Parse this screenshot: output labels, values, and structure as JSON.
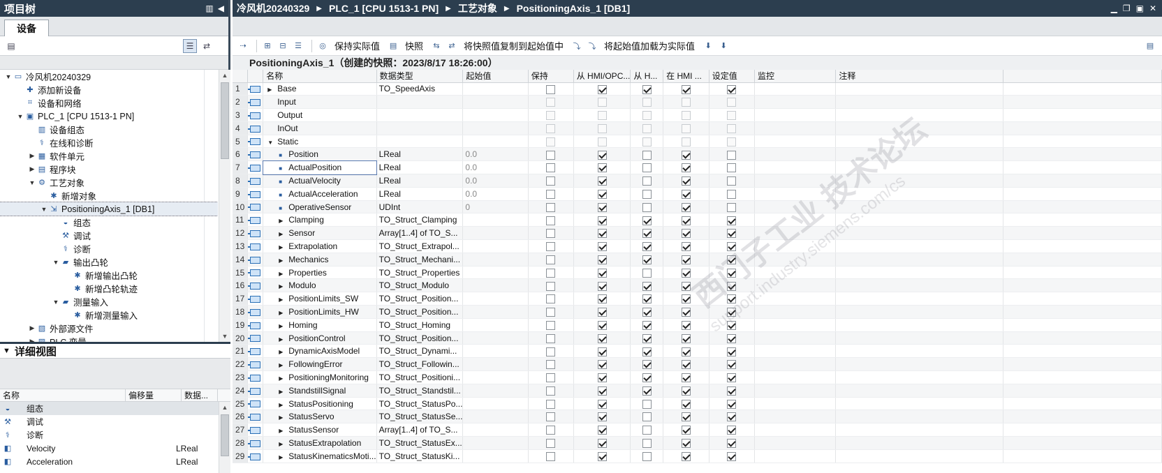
{
  "left": {
    "title": "项目树",
    "tab": "设备",
    "tree": [
      {
        "label": "冷风机20240329",
        "indent": 0,
        "exp": "▼",
        "icon": "project-icon"
      },
      {
        "label": "添加新设备",
        "indent": 1,
        "exp": "",
        "icon": "add-device-icon"
      },
      {
        "label": "设备和网络",
        "indent": 1,
        "exp": "",
        "icon": "network-icon"
      },
      {
        "label": "PLC_1 [CPU 1513-1 PN]",
        "indent": 1,
        "exp": "▼",
        "icon": "plc-icon"
      },
      {
        "label": "设备组态",
        "indent": 2,
        "exp": "",
        "icon": "device-config-icon"
      },
      {
        "label": "在线和诊断",
        "indent": 2,
        "exp": "",
        "icon": "diagnostics-icon"
      },
      {
        "label": "软件单元",
        "indent": 2,
        "exp": "▶",
        "icon": "software-unit-icon"
      },
      {
        "label": "程序块",
        "indent": 2,
        "exp": "▶",
        "icon": "program-blocks-icon"
      },
      {
        "label": "工艺对象",
        "indent": 2,
        "exp": "▼",
        "icon": "technology-objects-icon"
      },
      {
        "label": "新增对象",
        "indent": 3,
        "exp": "",
        "icon": "add-object-icon"
      },
      {
        "label": "PositioningAxis_1 [DB1]",
        "indent": 3,
        "exp": "▼",
        "icon": "axis-icon",
        "sel": true
      },
      {
        "label": "组态",
        "indent": 4,
        "exp": "",
        "icon": "configuration-icon"
      },
      {
        "label": "调试",
        "indent": 4,
        "exp": "",
        "icon": "commissioning-icon"
      },
      {
        "label": "诊断",
        "indent": 4,
        "exp": "",
        "icon": "diagnostics-icon"
      },
      {
        "label": "输出凸轮",
        "indent": 4,
        "exp": "▼",
        "icon": "folder-icon"
      },
      {
        "label": "新增输出凸轮",
        "indent": 5,
        "exp": "",
        "icon": "add-object-icon"
      },
      {
        "label": "新增凸轮轨迹",
        "indent": 5,
        "exp": "",
        "icon": "add-object-icon"
      },
      {
        "label": "测量输入",
        "indent": 4,
        "exp": "▼",
        "icon": "folder-icon"
      },
      {
        "label": "新增测量输入",
        "indent": 5,
        "exp": "",
        "icon": "add-object-icon"
      },
      {
        "label": "外部源文件",
        "indent": 2,
        "exp": "▶",
        "icon": "source-files-icon"
      },
      {
        "label": "PLC 变量",
        "indent": 2,
        "exp": "▶",
        "icon": "tags-icon"
      }
    ],
    "detail": {
      "title": "详细视图",
      "headers": [
        "名称",
        "偏移量",
        "数据..."
      ],
      "rows": [
        {
          "name": "组态",
          "type": "",
          "sel": true
        },
        {
          "name": "调试",
          "type": ""
        },
        {
          "name": "诊断",
          "type": ""
        },
        {
          "name": "Velocity",
          "type": "LReal"
        },
        {
          "name": "Acceleration",
          "type": "LReal"
        }
      ]
    }
  },
  "right": {
    "breadcrumb": [
      "冷风机20240329",
      "PLC_1 [CPU 1513-1 PN]",
      "工艺对象",
      "PositioningAxis_1 [DB1]"
    ],
    "toolbar": {
      "keep_actual": "保持实际值",
      "snapshot": "快照",
      "copy_snapshot": "将快照值复制到起始值中",
      "load_start": "将起始值加载为实际值"
    },
    "snapshot_title": "PositioningAxis_1（创建的快照：2023/8/17 18:26:00）",
    "columns": [
      "",
      "",
      "名称",
      "数据类型",
      "起始值",
      "保持",
      "从 HMI/OPC...",
      "从 H...",
      "在 HMI ...",
      "设定值",
      "监控",
      "注释"
    ],
    "rows": [
      {
        "n": "1",
        "name": "Base",
        "type": "TO_SpeedAxis",
        "start": "",
        "lvl": 0,
        "mk": "arrow",
        "c": [
          0,
          1,
          1,
          1,
          1
        ]
      },
      {
        "n": "2",
        "name": "Input",
        "type": "",
        "start": "",
        "lvl": 0,
        "mk": "",
        "c": [
          0,
          0,
          0,
          0,
          0
        ]
      },
      {
        "n": "3",
        "name": "Output",
        "type": "",
        "start": "",
        "lvl": 0,
        "mk": "",
        "c": [
          0,
          0,
          0,
          0,
          0
        ]
      },
      {
        "n": "4",
        "name": "InOut",
        "type": "",
        "start": "",
        "lvl": 0,
        "mk": "",
        "c": [
          0,
          0,
          0,
          0,
          0
        ]
      },
      {
        "n": "5",
        "name": "Static",
        "type": "",
        "start": "",
        "lvl": 0,
        "mk": "down",
        "c": [
          0,
          0,
          0,
          0,
          0
        ]
      },
      {
        "n": "6",
        "name": "Position",
        "type": "LReal",
        "start": "0.0",
        "lvl": 1,
        "mk": "bullet",
        "c": [
          0,
          1,
          0,
          1,
          0
        ]
      },
      {
        "n": "7",
        "name": "ActualPosition",
        "type": "LReal",
        "start": "0.0",
        "lvl": 1,
        "mk": "bullet",
        "c": [
          0,
          1,
          0,
          1,
          0
        ],
        "sel": true
      },
      {
        "n": "8",
        "name": "ActualVelocity",
        "type": "LReal",
        "start": "0.0",
        "lvl": 1,
        "mk": "bullet",
        "c": [
          0,
          1,
          0,
          1,
          0
        ]
      },
      {
        "n": "9",
        "name": "ActualAcceleration",
        "type": "LReal",
        "start": "0.0",
        "lvl": 1,
        "mk": "bullet",
        "c": [
          0,
          1,
          0,
          1,
          0
        ]
      },
      {
        "n": "10",
        "name": "OperativeSensor",
        "type": "UDInt",
        "start": "0",
        "lvl": 1,
        "mk": "bullet",
        "c": [
          0,
          1,
          0,
          1,
          0
        ]
      },
      {
        "n": "11",
        "name": "Clamping",
        "type": "TO_Struct_Clamping",
        "start": "",
        "lvl": 1,
        "mk": "arrow",
        "c": [
          0,
          1,
          1,
          1,
          1
        ]
      },
      {
        "n": "12",
        "name": "Sensor",
        "type": "Array[1..4] of TO_S...",
        "start": "",
        "lvl": 1,
        "mk": "arrow",
        "c": [
          0,
          1,
          1,
          1,
          1
        ]
      },
      {
        "n": "13",
        "name": "Extrapolation",
        "type": "TO_Struct_Extrapol...",
        "start": "",
        "lvl": 1,
        "mk": "arrow",
        "c": [
          0,
          1,
          1,
          1,
          1
        ]
      },
      {
        "n": "14",
        "name": "Mechanics",
        "type": "TO_Struct_Mechani...",
        "start": "",
        "lvl": 1,
        "mk": "arrow",
        "c": [
          0,
          1,
          1,
          1,
          1
        ]
      },
      {
        "n": "15",
        "name": "Properties",
        "type": "TO_Struct_Properties",
        "start": "",
        "lvl": 1,
        "mk": "arrow",
        "c": [
          0,
          1,
          0,
          1,
          1
        ]
      },
      {
        "n": "16",
        "name": "Modulo",
        "type": "TO_Struct_Modulo",
        "start": "",
        "lvl": 1,
        "mk": "arrow",
        "c": [
          0,
          1,
          1,
          1,
          1
        ]
      },
      {
        "n": "17",
        "name": "PositionLimits_SW",
        "type": "TO_Struct_Position...",
        "start": "",
        "lvl": 1,
        "mk": "arrow",
        "c": [
          0,
          1,
          1,
          1,
          1
        ]
      },
      {
        "n": "18",
        "name": "PositionLimits_HW",
        "type": "TO_Struct_Position...",
        "start": "",
        "lvl": 1,
        "mk": "arrow",
        "c": [
          0,
          1,
          1,
          1,
          1
        ]
      },
      {
        "n": "19",
        "name": "Homing",
        "type": "TO_Struct_Homing",
        "start": "",
        "lvl": 1,
        "mk": "arrow",
        "c": [
          0,
          1,
          1,
          1,
          1
        ]
      },
      {
        "n": "20",
        "name": "PositionControl",
        "type": "TO_Struct_Position...",
        "start": "",
        "lvl": 1,
        "mk": "arrow",
        "c": [
          0,
          1,
          1,
          1,
          1
        ]
      },
      {
        "n": "21",
        "name": "DynamicAxisModel",
        "type": "TO_Struct_Dynami...",
        "start": "",
        "lvl": 1,
        "mk": "arrow",
        "c": [
          0,
          1,
          1,
          1,
          1
        ]
      },
      {
        "n": "22",
        "name": "FollowingError",
        "type": "TO_Struct_Followin...",
        "start": "",
        "lvl": 1,
        "mk": "arrow",
        "c": [
          0,
          1,
          1,
          1,
          1
        ]
      },
      {
        "n": "23",
        "name": "PositioningMonitoring",
        "type": "TO_Struct_Positioni...",
        "start": "",
        "lvl": 1,
        "mk": "arrow",
        "c": [
          0,
          1,
          1,
          1,
          1
        ]
      },
      {
        "n": "24",
        "name": "StandstillSignal",
        "type": "TO_Struct_Standstil...",
        "start": "",
        "lvl": 1,
        "mk": "arrow",
        "c": [
          0,
          1,
          1,
          1,
          1
        ]
      },
      {
        "n": "25",
        "name": "StatusPositioning",
        "type": "TO_Struct_StatusPo...",
        "start": "",
        "lvl": 1,
        "mk": "arrow",
        "c": [
          0,
          1,
          0,
          1,
          1
        ]
      },
      {
        "n": "26",
        "name": "StatusServo",
        "type": "TO_Struct_StatusSe...",
        "start": "",
        "lvl": 1,
        "mk": "arrow",
        "c": [
          0,
          1,
          0,
          1,
          1
        ]
      },
      {
        "n": "27",
        "name": "StatusSensor",
        "type": "Array[1..4] of TO_S...",
        "start": "",
        "lvl": 1,
        "mk": "arrow",
        "c": [
          0,
          1,
          0,
          1,
          1
        ]
      },
      {
        "n": "28",
        "name": "StatusExtrapolation",
        "type": "TO_Struct_StatusEx...",
        "start": "",
        "lvl": 1,
        "mk": "arrow",
        "c": [
          0,
          1,
          0,
          1,
          1
        ]
      },
      {
        "n": "29",
        "name": "StatusKinematicsMoti...",
        "type": "TO_Struct_StatusKi...",
        "start": "",
        "lvl": 1,
        "mk": "arrow",
        "c": [
          0,
          1,
          0,
          1,
          1
        ]
      }
    ],
    "watermark": "西门子工业 技术论坛",
    "watermark2": "support.industry.siemens.com/cs"
  }
}
